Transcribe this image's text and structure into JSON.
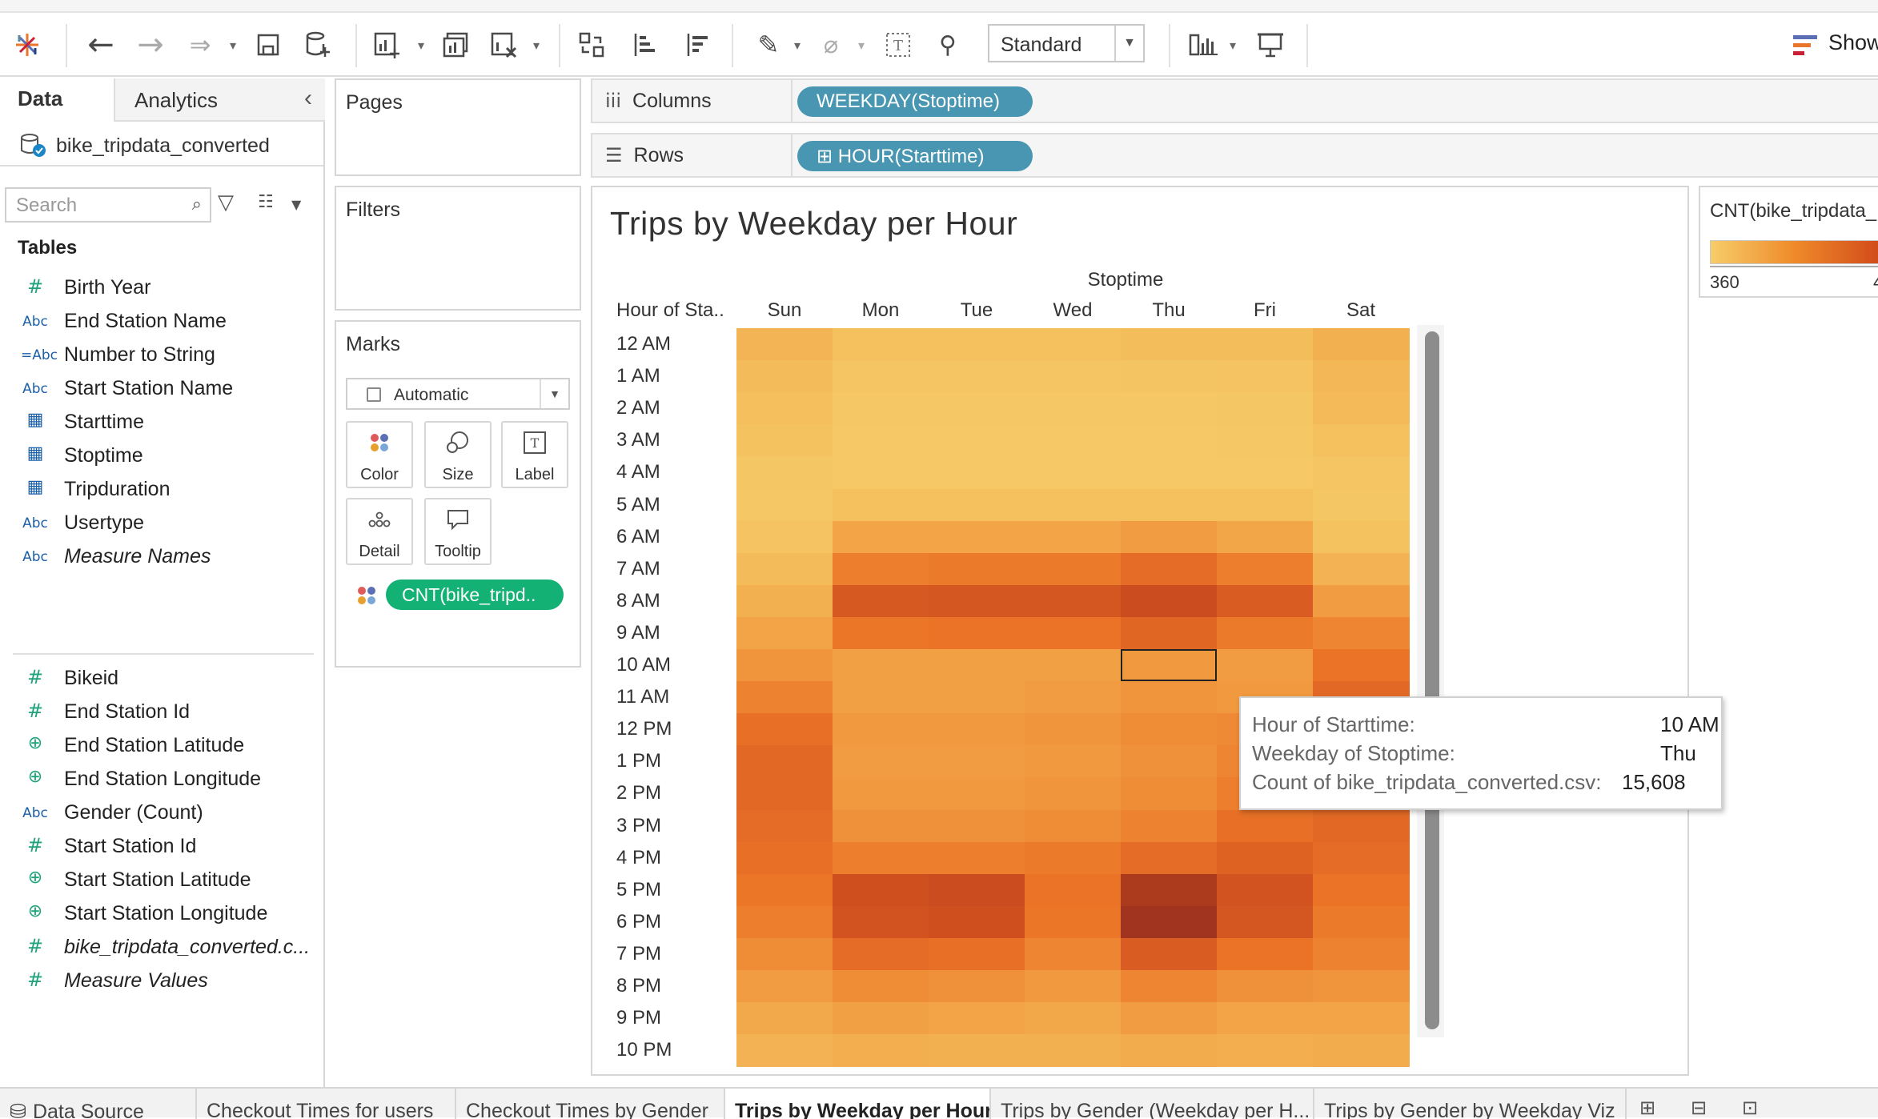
{
  "toolbar": {
    "standard_value": "Standard",
    "show_me_label": "Show"
  },
  "data_pane": {
    "tab_data": "Data",
    "tab_analytics": "Analytics",
    "data_source": "bike_tripdata_converted",
    "search_placeholder": "Search",
    "tables_header": "Tables",
    "dimensions": [
      {
        "type": "#",
        "name": "Birth Year"
      },
      {
        "type": "Abc",
        "name": "End Station Name"
      },
      {
        "type": "=Abc",
        "name": "Number to String"
      },
      {
        "type": "Abc",
        "name": "Start Station Name"
      },
      {
        "type": "cal",
        "name": "Starttime"
      },
      {
        "type": "cal",
        "name": "Stoptime"
      },
      {
        "type": "cal",
        "name": "Tripduration"
      },
      {
        "type": "Abc",
        "name": "Usertype"
      },
      {
        "type": "Abc",
        "name": "Measure Names"
      }
    ],
    "measures": [
      {
        "type": "#",
        "name": "Bikeid"
      },
      {
        "type": "#",
        "name": "End Station Id"
      },
      {
        "type": "globe",
        "name": "End Station Latitude"
      },
      {
        "type": "globe",
        "name": "End Station Longitude"
      },
      {
        "type": "Abc",
        "name": "Gender (Count)"
      },
      {
        "type": "#",
        "name": "Start Station Id"
      },
      {
        "type": "globe",
        "name": "Start Station Latitude"
      },
      {
        "type": "globe",
        "name": "Start Station Longitude"
      },
      {
        "type": "#",
        "name": "bike_tripdata_converted.c..."
      },
      {
        "type": "#",
        "name": "Measure Values"
      }
    ]
  },
  "cards": {
    "pages": "Pages",
    "filters": "Filters",
    "marks": "Marks",
    "mark_type": "Automatic",
    "mark_buttons": [
      "Color",
      "Size",
      "Label",
      "Detail",
      "Tooltip"
    ],
    "color_pill": "CNT(bike_tripd.."
  },
  "shelves": {
    "columns_label": "Columns",
    "columns_pill": "WEEKDAY(Stoptime)",
    "rows_label": "Rows",
    "rows_pill": "⊞ HOUR(Starttime)"
  },
  "viz": {
    "title": "Trips by Weekday per Hour",
    "column_axis_title": "Stoptime",
    "row_header": "Hour of Sta..",
    "legend_title": "CNT(bike_tripdata_",
    "legend_min": "360",
    "legend_max": "4"
  },
  "tooltip": {
    "rows": [
      {
        "label": "Hour of Starttime:",
        "value": "10 AM"
      },
      {
        "label": "Weekday of Stoptime:",
        "value": "Thu"
      },
      {
        "label": "Count of bike_tripdata_converted.csv:",
        "value": "15,608"
      }
    ]
  },
  "colors": {
    "pill_blue": "#4996b2",
    "pill_green": "#13b174",
    "heat_low": "#f6cd6a",
    "heat_high": "#a3361e"
  },
  "chart_data": {
    "type": "heatmap",
    "title": "Trips by Weekday per Hour",
    "x_axis_title": "Stoptime",
    "y_axis_title": "Hour of Sta..",
    "columns": [
      "Sun",
      "Mon",
      "Tue",
      "Wed",
      "Thu",
      "Fri",
      "Sat"
    ],
    "rows": [
      "12 AM",
      "1 AM",
      "2 AM",
      "3 AM",
      "4 AM",
      "5 AM",
      "6 AM",
      "7 AM",
      "8 AM",
      "9 AM",
      "10 AM",
      "11 AM",
      "12 PM",
      "1 PM",
      "2 PM",
      "3 PM",
      "4 PM",
      "5 PM",
      "6 PM",
      "7 PM",
      "8 PM",
      "9 PM",
      "10 PM"
    ],
    "color_legend_min": 360,
    "values": [
      [
        0.22,
        0.12,
        0.12,
        0.12,
        0.14,
        0.14,
        0.26
      ],
      [
        0.16,
        0.07,
        0.07,
        0.07,
        0.08,
        0.09,
        0.2
      ],
      [
        0.13,
        0.05,
        0.05,
        0.05,
        0.05,
        0.06,
        0.17
      ],
      [
        0.1,
        0.04,
        0.04,
        0.04,
        0.04,
        0.05,
        0.12
      ],
      [
        0.06,
        0.04,
        0.04,
        0.04,
        0.04,
        0.04,
        0.07
      ],
      [
        0.05,
        0.12,
        0.12,
        0.12,
        0.12,
        0.11,
        0.06
      ],
      [
        0.09,
        0.36,
        0.36,
        0.36,
        0.4,
        0.35,
        0.1
      ],
      [
        0.16,
        0.56,
        0.58,
        0.58,
        0.66,
        0.56,
        0.24
      ],
      [
        0.26,
        0.78,
        0.8,
        0.8,
        0.86,
        0.76,
        0.4
      ],
      [
        0.36,
        0.6,
        0.62,
        0.62,
        0.7,
        0.58,
        0.52
      ],
      [
        0.44,
        0.38,
        0.38,
        0.38,
        0.42,
        0.4,
        0.62
      ],
      [
        0.54,
        0.38,
        0.38,
        0.4,
        0.44,
        0.42,
        0.68
      ],
      [
        0.64,
        0.42,
        0.42,
        0.44,
        0.48,
        0.5,
        0.7
      ],
      [
        0.68,
        0.4,
        0.4,
        0.42,
        0.46,
        0.52,
        0.7
      ],
      [
        0.68,
        0.42,
        0.42,
        0.44,
        0.48,
        0.56,
        0.7
      ],
      [
        0.66,
        0.46,
        0.46,
        0.48,
        0.54,
        0.64,
        0.68
      ],
      [
        0.64,
        0.56,
        0.56,
        0.58,
        0.66,
        0.72,
        0.66
      ],
      [
        0.6,
        0.84,
        0.86,
        0.62,
        0.96,
        0.82,
        0.62
      ],
      [
        0.56,
        0.82,
        0.84,
        0.6,
        1.0,
        0.8,
        0.58
      ],
      [
        0.48,
        0.66,
        0.64,
        0.52,
        0.76,
        0.62,
        0.54
      ],
      [
        0.4,
        0.48,
        0.46,
        0.42,
        0.52,
        0.46,
        0.44
      ],
      [
        0.32,
        0.38,
        0.36,
        0.34,
        0.4,
        0.36,
        0.36
      ],
      [
        0.24,
        0.28,
        0.26,
        0.26,
        0.3,
        0.28,
        0.3
      ]
    ],
    "selected": {
      "row": "10 AM",
      "column": "Thu",
      "value": 15608
    }
  },
  "bottom_tabs": [
    {
      "label": "Data Source",
      "active": false
    },
    {
      "label": "Checkout Times for users",
      "active": false
    },
    {
      "label": "Checkout Times by Gender",
      "active": false
    },
    {
      "label": "Trips by Weekday per Hour",
      "active": true
    },
    {
      "label": "Trips by Gender (Weekday per H...",
      "active": false
    },
    {
      "label": "Trips by Gender by Weekday Viz",
      "active": false
    }
  ]
}
